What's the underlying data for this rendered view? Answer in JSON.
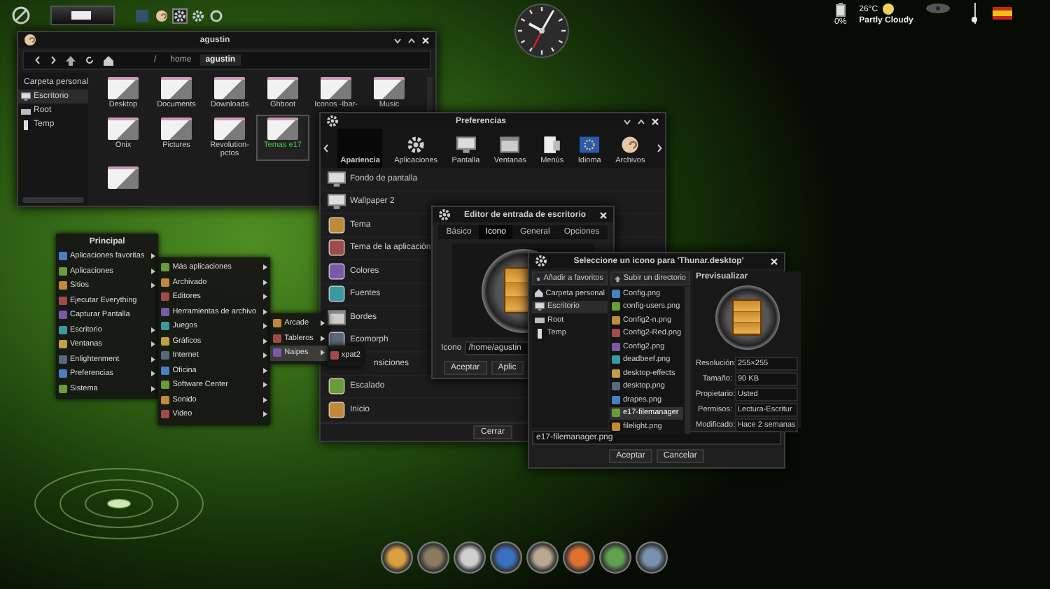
{
  "top_panel": {
    "battery": "0%",
    "temperature": "26°C",
    "weather": "Partly Cloudy",
    "volume": {
      "level": 0.1
    }
  },
  "file_manager": {
    "title": "agustin",
    "path": [
      {
        "label": "/",
        "selected": false
      },
      {
        "label": "home",
        "selected": false
      },
      {
        "label": "agustin",
        "selected": true
      }
    ],
    "places": [
      {
        "label": "Carpeta personal",
        "selected": false
      },
      {
        "label": "Escritorio",
        "selected": true
      },
      {
        "label": "Root",
        "selected": false
      },
      {
        "label": "Temp",
        "selected": false
      }
    ],
    "folder_rows": [
      [
        {
          "label": "Desktop",
          "selected": false
        },
        {
          "label": "Documents",
          "selected": false
        },
        {
          "label": "Downloads",
          "selected": false
        },
        {
          "label": "Ghboot",
          "selected": false
        },
        {
          "label": "Iconos -Ibar-",
          "selected": false
        },
        {
          "label": "Music",
          "selected": false
        }
      ],
      [
        {
          "label": "Onix",
          "selected": false
        },
        {
          "label": "Pictures",
          "selected": false
        },
        {
          "label": "Revolution-pctos",
          "selected": false
        },
        {
          "label": "Temas e17",
          "selected": true
        }
      ],
      [
        {
          "selected": false
        }
      ]
    ]
  },
  "preferences": {
    "title": "Preferencias",
    "categories": [
      {
        "label": "Apariencia",
        "selected": true
      },
      {
        "label": "Aplicaciones",
        "selected": false
      },
      {
        "label": "Pantalla",
        "selected": false
      },
      {
        "label": "Ventanas",
        "selected": false
      },
      {
        "label": "Menús",
        "selected": false
      },
      {
        "label": "Idioma",
        "selected": false
      },
      {
        "label": "Archivos",
        "selected": false
      }
    ],
    "items": [
      {
        "label": "Fondo de pantalla",
        "kind": "entry"
      },
      {
        "label": "Wallpaper 2",
        "kind": "entry"
      },
      {
        "label": "Tema",
        "kind": "entry"
      },
      {
        "label": "Tema de la aplicación",
        "kind": "entry"
      },
      {
        "label": "Colores",
        "kind": "entry"
      },
      {
        "label": "Fuentes",
        "kind": "entry"
      },
      {
        "label": "Bordes",
        "kind": "entry"
      },
      {
        "label": "Ecomorph",
        "kind": "entry"
      },
      {
        "label": "nsiciones",
        "kind": "partial"
      },
      {
        "label": "Escalado",
        "kind": "entry"
      },
      {
        "label": "Inicio",
        "kind": "entry"
      }
    ],
    "button": "Cerrar"
  },
  "entry_editor": {
    "title": "Editor de entrada de escritorio",
    "tabs": [
      {
        "label": "Básico",
        "selected": false
      },
      {
        "label": "Icono",
        "selected": true
      },
      {
        "label": "General",
        "selected": false
      },
      {
        "label": "Opciones",
        "selected": false
      }
    ],
    "icon_label": "Icono",
    "icon_path": "/home/agustin",
    "buttons": [
      "Aceptar",
      "Aplic"
    ]
  },
  "icon_chooser": {
    "title": "Seleccione un icono para 'Thunar.desktop'",
    "add_favorite": "Añadir a favoritos",
    "up_directory": "Subir un directorio",
    "places": [
      {
        "label": "Carpeta personal",
        "selected": false
      },
      {
        "label": "Escritorio",
        "selected": true
      },
      {
        "label": "Root",
        "selected": false
      },
      {
        "label": "Temp",
        "selected": false
      }
    ],
    "files": [
      {
        "label": "Config.png",
        "selected": false
      },
      {
        "label": "config-users.png",
        "selected": false
      },
      {
        "label": "Config2-n.png",
        "selected": false
      },
      {
        "label": "Config2-Red.png",
        "selected": false
      },
      {
        "label": "Config2.png",
        "selected": false
      },
      {
        "label": "deadbeef.png",
        "selected": false
      },
      {
        "label": "desktop-effects",
        "selected": false
      },
      {
        "label": "desktop.png",
        "selected": false
      },
      {
        "label": "drapes.png",
        "selected": false
      },
      {
        "label": "e17-filemanager",
        "selected": true
      },
      {
        "label": "filelight.png",
        "selected": false
      }
    ],
    "preview": {
      "title": "Previsualizar",
      "properties": [
        {
          "label": "Resolución:",
          "value": "255×255"
        },
        {
          "label": "Tamaño:",
          "value": "90 KB"
        },
        {
          "label": "Propietario:",
          "value": "Usted"
        },
        {
          "label": "Permisos:",
          "value": "Lectura-Escritur"
        },
        {
          "label": "Modificado:",
          "value": "Hace 2 semanas"
        }
      ]
    },
    "filename": "e17-filemanager.png",
    "buttons": [
      "Aceptar",
      "Cancelar"
    ]
  },
  "menus": [
    {
      "title": "Principal",
      "items": [
        {
          "label": "Aplicaciones favoritas",
          "submenu": true,
          "selected": false
        },
        {
          "label": "Aplicaciones",
          "submenu": true,
          "selected": false
        },
        {
          "label": "Sitios",
          "submenu": true,
          "selected": false
        },
        {
          "label": "Ejecutar Everything",
          "submenu": false,
          "selected": false
        },
        {
          "label": "Capturar Pantalla",
          "submenu": false,
          "selected": false
        },
        {
          "label": "Escritorio",
          "submenu": true,
          "selected": false
        },
        {
          "label": "Ventanas",
          "submenu": true,
          "selected": false
        },
        {
          "label": "Enlightenment",
          "submenu": true,
          "selected": false
        },
        {
          "label": "Preferencias",
          "submenu": true,
          "selected": false
        },
        {
          "label": "Sistema",
          "submenu": true,
          "selected": false
        }
      ]
    },
    {
      "items": [
        {
          "label": "Más aplicaciones",
          "submenu": true,
          "selected": false
        },
        {
          "label": "Archivado",
          "submenu": true,
          "selected": false
        },
        {
          "label": "Editores",
          "submenu": true,
          "selected": false
        },
        {
          "label": "Herramientas de archivo",
          "submenu": true,
          "selected": false
        },
        {
          "label": "Juegos",
          "submenu": true,
          "selected": false
        },
        {
          "label": "Gráficos",
          "submenu": true,
          "selected": false
        },
        {
          "label": "Internet",
          "submenu": true,
          "selected": false
        },
        {
          "label": "Oficina",
          "submenu": true,
          "selected": false
        },
        {
          "label": "Software Center",
          "submenu": true,
          "selected": false
        },
        {
          "label": "Sonido",
          "submenu": true,
          "selected": false
        },
        {
          "label": "Video",
          "submenu": true,
          "selected": false
        }
      ]
    },
    {
      "items": [
        {
          "label": "Arcade",
          "submenu": true,
          "selected": false
        },
        {
          "label": "Tableros",
          "submenu": true,
          "selected": false
        },
        {
          "label": "Naipes",
          "submenu": true,
          "selected": true
        }
      ]
    },
    {
      "items": [
        {
          "label": "xpat2",
          "submenu": false,
          "selected": false
        }
      ]
    }
  ]
}
